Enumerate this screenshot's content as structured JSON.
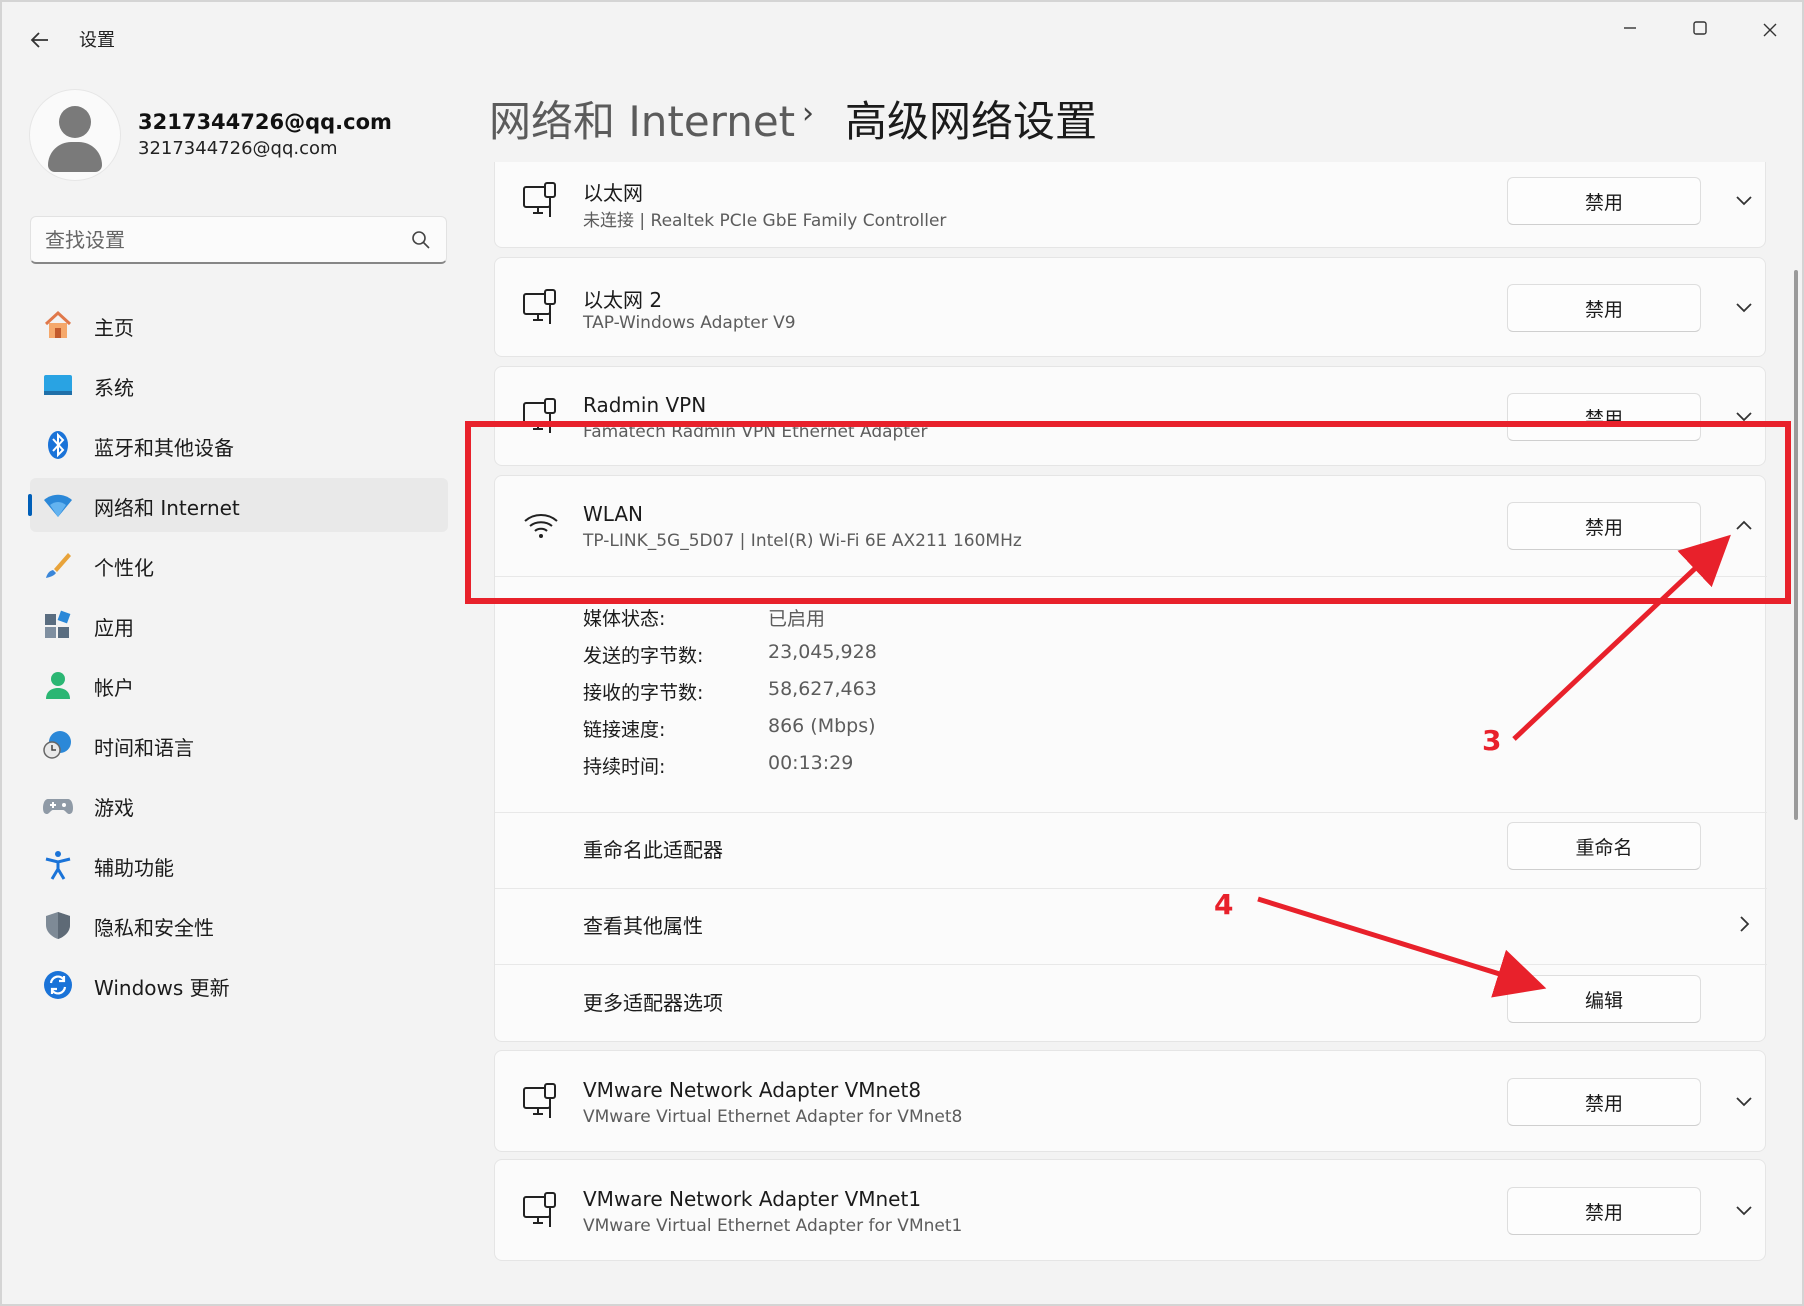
{
  "window": {
    "title": "设置"
  },
  "profile": {
    "name": "3217344726@qq.com",
    "email": "3217344726@qq.com"
  },
  "search": {
    "placeholder": "查找设置"
  },
  "nav": {
    "items": [
      {
        "label": "主页",
        "icon": "home-icon"
      },
      {
        "label": "系统",
        "icon": "system-icon"
      },
      {
        "label": "蓝牙和其他设备",
        "icon": "bluetooth-icon"
      },
      {
        "label": "网络和 Internet",
        "icon": "wifi-icon",
        "active": true
      },
      {
        "label": "个性化",
        "icon": "brush-icon"
      },
      {
        "label": "应用",
        "icon": "apps-icon"
      },
      {
        "label": "帐户",
        "icon": "account-icon"
      },
      {
        "label": "时间和语言",
        "icon": "globe-clock-icon"
      },
      {
        "label": "游戏",
        "icon": "gamepad-icon"
      },
      {
        "label": "辅助功能",
        "icon": "accessibility-icon"
      },
      {
        "label": "隐私和安全性",
        "icon": "shield-icon"
      },
      {
        "label": "Windows 更新",
        "icon": "update-icon"
      }
    ]
  },
  "header": {
    "parent": "网络和 Internet",
    "separator": "›",
    "current": "高级网络设置"
  },
  "adapters": [
    {
      "title": "以太网",
      "subtitle": "未连接 | Realtek PCIe GbE Family Controller",
      "button": "禁用",
      "icon": "ethernet-icon"
    },
    {
      "title": "以太网 2",
      "subtitle": "TAP-Windows Adapter V9",
      "button": "禁用",
      "icon": "ethernet-icon"
    },
    {
      "title": "Radmin VPN",
      "subtitle": "Famatech Radmin VPN Ethernet Adapter",
      "button": "禁用",
      "icon": "ethernet-icon"
    },
    {
      "title": "WLAN",
      "subtitle": "TP-LINK_5G_5D07 | Intel(R) Wi-Fi 6E AX211 160MHz",
      "button": "禁用",
      "icon": "wifi-icon",
      "expanded": true
    },
    {
      "title": "VMware Network Adapter VMnet8",
      "subtitle": "VMware Virtual Ethernet Adapter for VMnet8",
      "button": "禁用",
      "icon": "ethernet-icon"
    },
    {
      "title": "VMware Network Adapter VMnet1",
      "subtitle": "VMware Virtual Ethernet Adapter for VMnet1",
      "button": "禁用",
      "icon": "ethernet-icon"
    }
  ],
  "wlan_details": {
    "rows": [
      {
        "label": "媒体状态:",
        "value": "已启用"
      },
      {
        "label": "发送的字节数:",
        "value": "23,045,928"
      },
      {
        "label": "接收的字节数:",
        "value": "58,627,463"
      },
      {
        "label": "链接速度:",
        "value": "866 (Mbps)"
      },
      {
        "label": "持续时间:",
        "value": "00:13:29"
      }
    ],
    "rename_label": "重命名此适配器",
    "rename_button": "重命名",
    "properties_label": "查看其他属性",
    "more_options_label": "更多适配器选项",
    "edit_button": "编辑"
  },
  "annotations": {
    "step3": "3",
    "step4": "4",
    "color": "#e8212b"
  }
}
